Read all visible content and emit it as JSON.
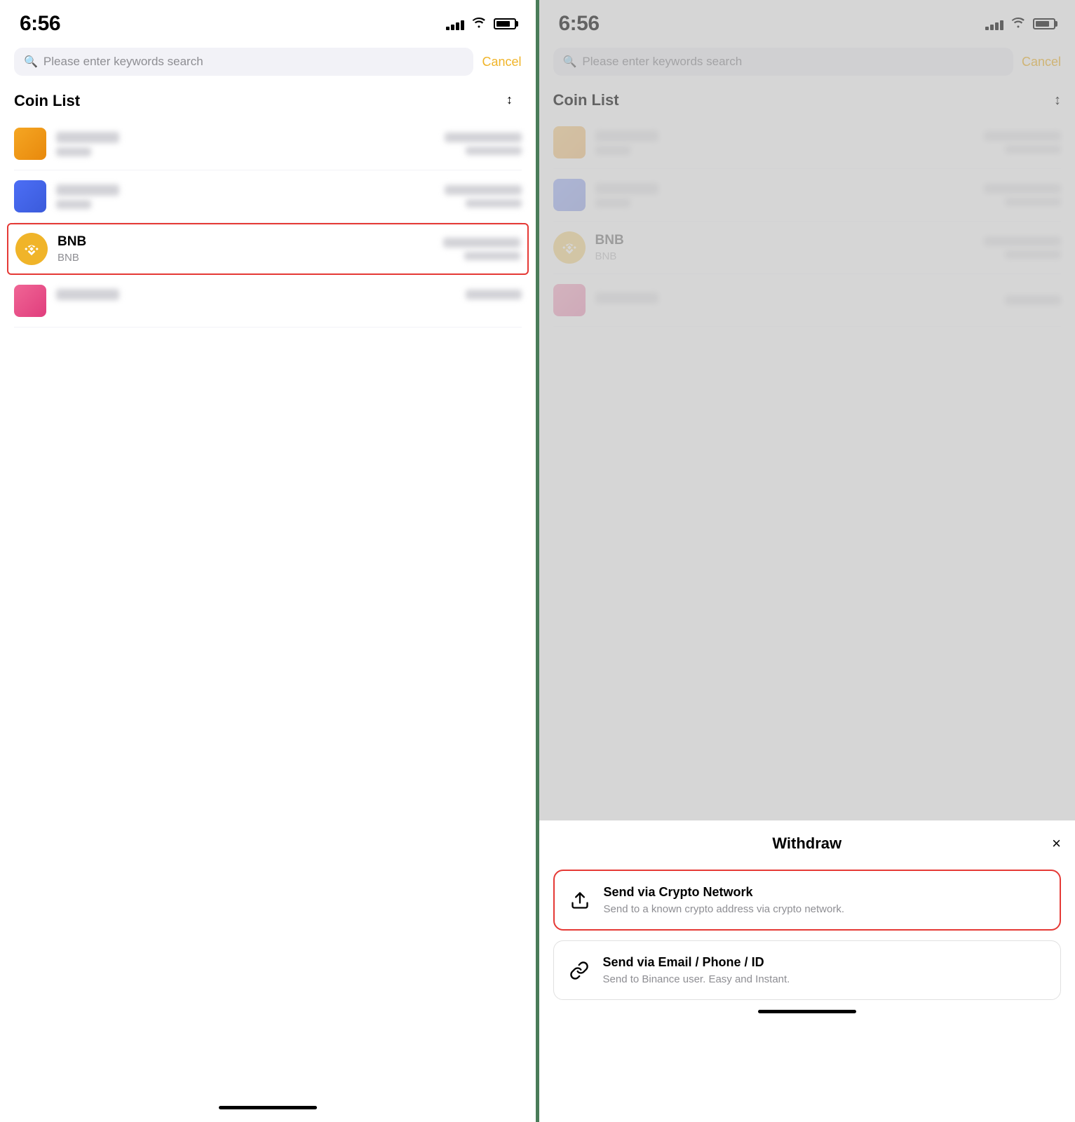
{
  "left": {
    "statusBar": {
      "time": "6:56"
    },
    "search": {
      "placeholder": "Please enter keywords search",
      "cancelLabel": "Cancel"
    },
    "coinList": {
      "title": "Coin List",
      "coins": [
        {
          "id": "coin1",
          "color": "orange",
          "highlighted": false,
          "showName": false
        },
        {
          "id": "coin2",
          "color": "blue",
          "highlighted": false,
          "showName": false
        },
        {
          "id": "bnb",
          "name": "BNB",
          "symbol": "BNB",
          "color": "bnb",
          "highlighted": true,
          "showName": true
        },
        {
          "id": "coin4",
          "color": "pink",
          "highlighted": false,
          "showName": false
        }
      ]
    }
  },
  "right": {
    "statusBar": {
      "time": "6:56"
    },
    "search": {
      "placeholder": "Please enter keywords search",
      "cancelLabel": "Cancel"
    },
    "coinList": {
      "title": "Coin List",
      "coins": [
        {
          "id": "coin1",
          "color": "orange",
          "highlighted": false,
          "showName": false
        },
        {
          "id": "coin2",
          "color": "blue",
          "highlighted": false,
          "showName": false
        },
        {
          "id": "bnb",
          "name": "BNB",
          "symbol": "BNB",
          "color": "bnb",
          "highlighted": false,
          "showName": true
        },
        {
          "id": "coin4",
          "color": "pink",
          "highlighted": false,
          "showName": false
        }
      ]
    },
    "modal": {
      "title": "Withdraw",
      "closeLabel": "×",
      "options": [
        {
          "id": "crypto-network",
          "title": "Send via Crypto Network",
          "desc": "Send to a known crypto address via crypto network.",
          "highlighted": true
        },
        {
          "id": "email-phone",
          "title": "Send via Email / Phone / ID",
          "desc": "Send to Binance user. Easy and Instant.",
          "highlighted": false
        }
      ]
    }
  }
}
